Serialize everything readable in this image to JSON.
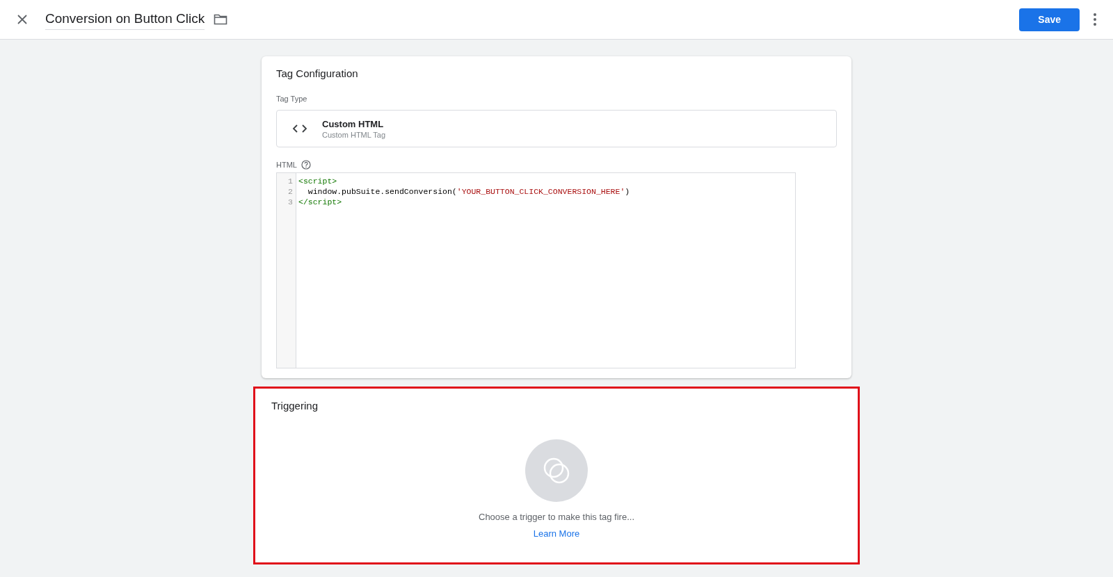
{
  "header": {
    "title": "Conversion on Button Click",
    "save_button": "Save"
  },
  "tag_configuration": {
    "title": "Tag Configuration",
    "tag_type_label": "Tag Type",
    "tag_type": {
      "name": "Custom HTML",
      "description": "Custom HTML Tag"
    },
    "html_label": "HTML",
    "code_lines": [
      {
        "number": "1",
        "tokens": [
          {
            "kind": "tag",
            "text": "<script>"
          }
        ]
      },
      {
        "number": "2",
        "tokens": [
          {
            "kind": "plain",
            "text": "  window.pubSuite.sendConversion("
          },
          {
            "kind": "string",
            "text": "'YOUR_BUTTON_CLICK_CONVERSION_HERE'"
          },
          {
            "kind": "plain",
            "text": ")"
          }
        ]
      },
      {
        "number": "3",
        "tokens": [
          {
            "kind": "tag",
            "text": "</script>"
          }
        ]
      }
    ]
  },
  "triggering": {
    "title": "Triggering",
    "highlighted": true,
    "message": "Choose a trigger to make this tag fire...",
    "link": "Learn More"
  }
}
